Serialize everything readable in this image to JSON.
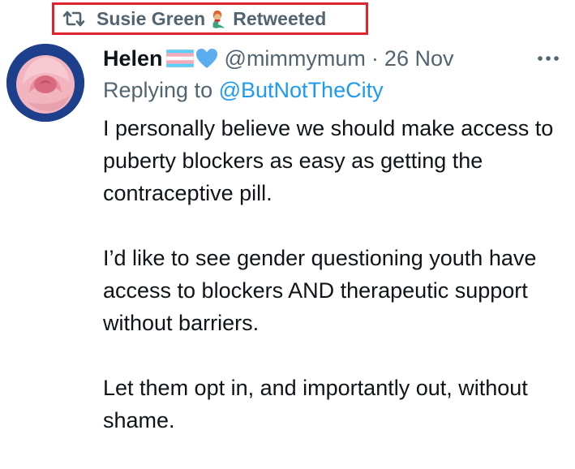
{
  "retweet": {
    "name": "Susie Green",
    "label": "Retweeted",
    "icon": "retweet-icon",
    "name_emoji": "mermaid-emoji",
    "highlight_color": "#e0242e"
  },
  "tweet": {
    "author_name": "Helen",
    "author_emojis": [
      "transgender-flag-emoji",
      "blue-heart-emoji"
    ],
    "handle": "@mimmymum",
    "separator": "·",
    "date": "26 Nov",
    "more_icon": "more-options-icon",
    "reply_prefix": "Replying to",
    "reply_to": "@ButNotTheCity",
    "paragraphs": [
      "I personally believe we should make access to puberty blockers as easy as getting the contraceptive pill.",
      "I’d like to see gender questioning youth have access to blockers AND  therapeutic support without barriers.",
      "Let them opt in, and importantly out, without shame."
    ]
  },
  "colors": {
    "text": "#0f1419",
    "secondary": "#536471",
    "link": "#1d9bf0"
  }
}
